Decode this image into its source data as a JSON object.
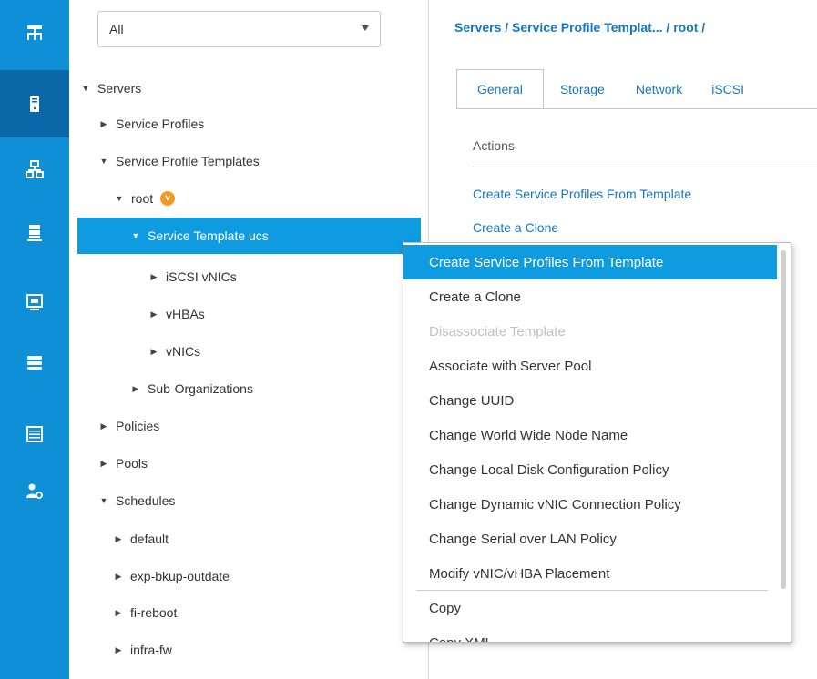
{
  "rail": {
    "items": [
      {
        "name": "equipment-icon",
        "active": false
      },
      {
        "name": "servers-icon",
        "active": true
      },
      {
        "name": "lan-icon",
        "active": false
      },
      {
        "name": "san-icon",
        "active": false
      },
      {
        "name": "vm-icon",
        "active": false
      },
      {
        "name": "storage-icon",
        "active": false
      },
      {
        "name": "chassis-icon",
        "active": false
      },
      {
        "name": "admin-icon",
        "active": false
      }
    ],
    "icon_color": "#ffffff",
    "active_color": "#0a67a8",
    "bg_color": "#0f8fd6"
  },
  "tree": {
    "filter_value": "All",
    "servers": "Servers",
    "service_profiles": "Service Profiles",
    "service_profile_templates": "Service Profile Templates",
    "root": "root",
    "service_template": "Service Template ucs",
    "iscsi_vnics": "iSCSI vNICs",
    "vhbas": "vHBAs",
    "vnics": "vNICs",
    "sub_orgs": "Sub-Organizations",
    "policies": "Policies",
    "pools": "Pools",
    "schedules": "Schedules",
    "default": "default",
    "exp_bkup": "exp-bkup-outdate",
    "fi_reboot": "fi-reboot",
    "infra_fw": "infra-fw",
    "expanded_marker": "▼",
    "collapsed_marker": "▶"
  },
  "content": {
    "breadcrumb": "Servers / Service Profile Templat... / root /",
    "tabs": [
      "General",
      "Storage",
      "Network",
      "iSCSI"
    ],
    "actions_title": "Actions",
    "actions": [
      "Create Service Profiles From Template",
      "Create a Clone"
    ]
  },
  "menu": {
    "items": [
      "Create Service Profiles From Template",
      "Create a Clone",
      "Disassociate Template",
      "Associate with Server Pool",
      "Change UUID",
      "Change World Wide Node Name",
      "Change Local Disk Configuration Policy",
      "Change Dynamic vNIC Connection Policy",
      "Change Serial over LAN Policy",
      "Modify vNIC/vHBA Placement",
      "Copy",
      "Copy XML"
    ],
    "highlight_color": "#0f9be0"
  }
}
